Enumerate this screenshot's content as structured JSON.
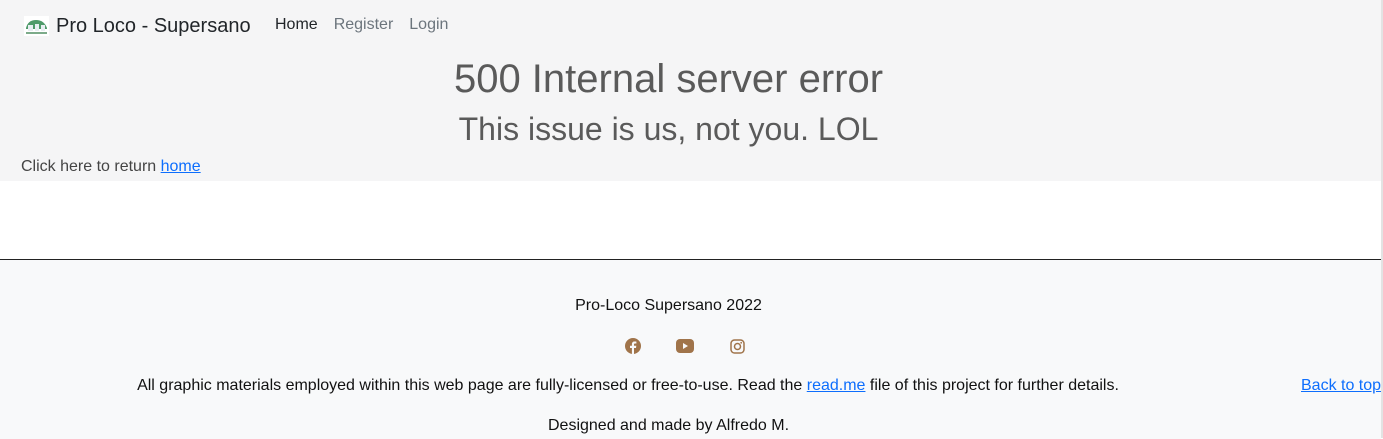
{
  "navbar": {
    "brand_logo_icon": "pro-loco-logo",
    "brand_name": "Pro Loco - Supersano",
    "links": [
      {
        "label": "Home",
        "active": true
      },
      {
        "label": "Register",
        "active": false
      },
      {
        "label": "Login",
        "active": false
      }
    ]
  },
  "error": {
    "title": "500 Internal server error",
    "subtitle": "This issue is us, not you. LOL",
    "return_prefix": "Click here to return",
    "return_link": "home"
  },
  "footer": {
    "copyright": "Pro-Loco Supersano 2022",
    "socials": [
      {
        "icon": "facebook-icon",
        "color": "#a0744a"
      },
      {
        "icon": "youtube-icon",
        "color": "#a0744a"
      },
      {
        "icon": "instagram-icon",
        "color": "#a0744a"
      }
    ],
    "disclaimer_before": "All graphic materials employed within this web page are fully-licensed or free-to-use. Read the",
    "disclaimer_link": "read.me",
    "disclaimer_after": "file of this project for further details.",
    "back_to_top": "Back to top",
    "designed_by": "Designed and made by Alfredo M."
  },
  "colors": {
    "link": "#0d6efd",
    "social_icon": "#a0744a",
    "header_bg": "#f5f5f6",
    "footer_bg": "#f8f9fa"
  }
}
